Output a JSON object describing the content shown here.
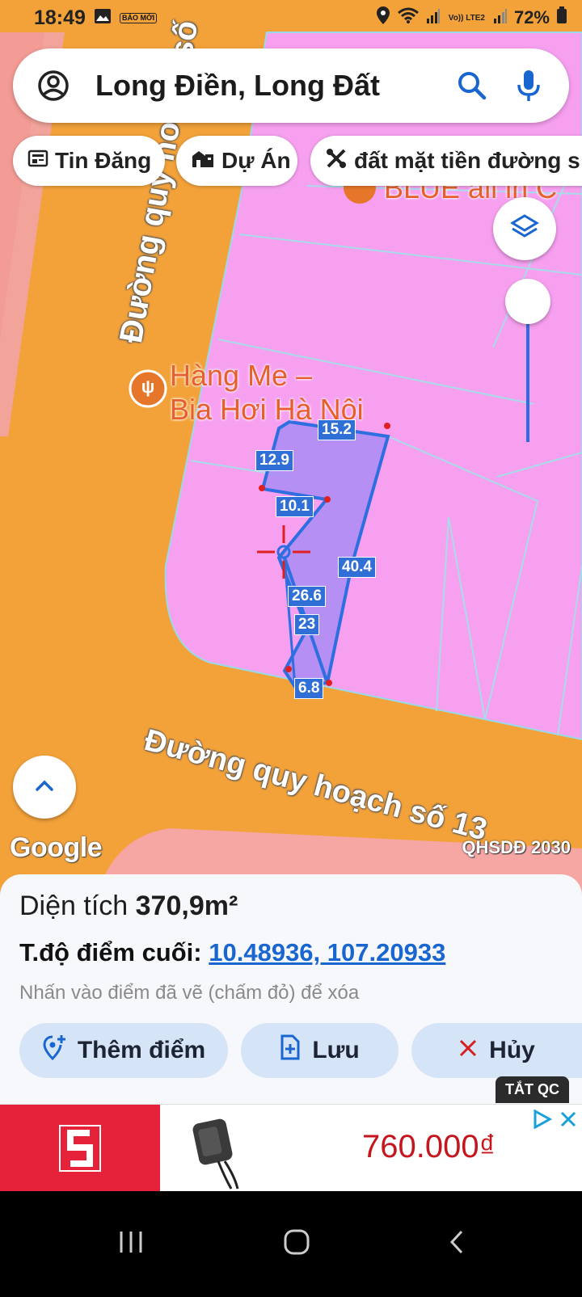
{
  "status_bar": {
    "time": "18:49",
    "badge": "BÁO MỚI",
    "network": "Vo)) LTE2",
    "battery": "72%"
  },
  "search": {
    "query": "Long Điền, Long Đất"
  },
  "chips": [
    {
      "label": "Tin Đăng",
      "icon": "newspaper-icon"
    },
    {
      "label": "Dự Án",
      "icon": "buildings-icon"
    },
    {
      "label": "đất mặt tiền đường s",
      "icon": "tools-icon"
    }
  ],
  "map": {
    "road_vertical": "Đường quy hoạch số",
    "road_bottom": "Đường quy hoạch số 13",
    "poi_name_line1": "Hàng Me –",
    "poi_name_line2": "Bia Hơi Hà Nội",
    "poi_top": "BLUE all in C",
    "measurements": [
      "15.2",
      "12.9",
      "10.1",
      "40.4",
      "26.6",
      "23",
      "6.8"
    ],
    "google": "Google",
    "layer_tag": "QHSDĐ 2030"
  },
  "panel": {
    "area_label": "Diện tích",
    "area_value": "370,9m²",
    "coord_label": "T.độ điểm cuối:",
    "coord_value": "10.48936, 107.20933",
    "hint": "Nhấn vào điểm đã vẽ (chấm đỏ) để xóa",
    "add_point": "Thêm điểm",
    "save": "Lưu",
    "cancel": "Hủy"
  },
  "ad": {
    "tag": "TẮT QC",
    "price": "760.000₫"
  },
  "colors": {
    "road": "#f3a23a",
    "zone": "#f7a0f0",
    "parcel": "#a98cf3",
    "accent": "#1a66d0"
  }
}
